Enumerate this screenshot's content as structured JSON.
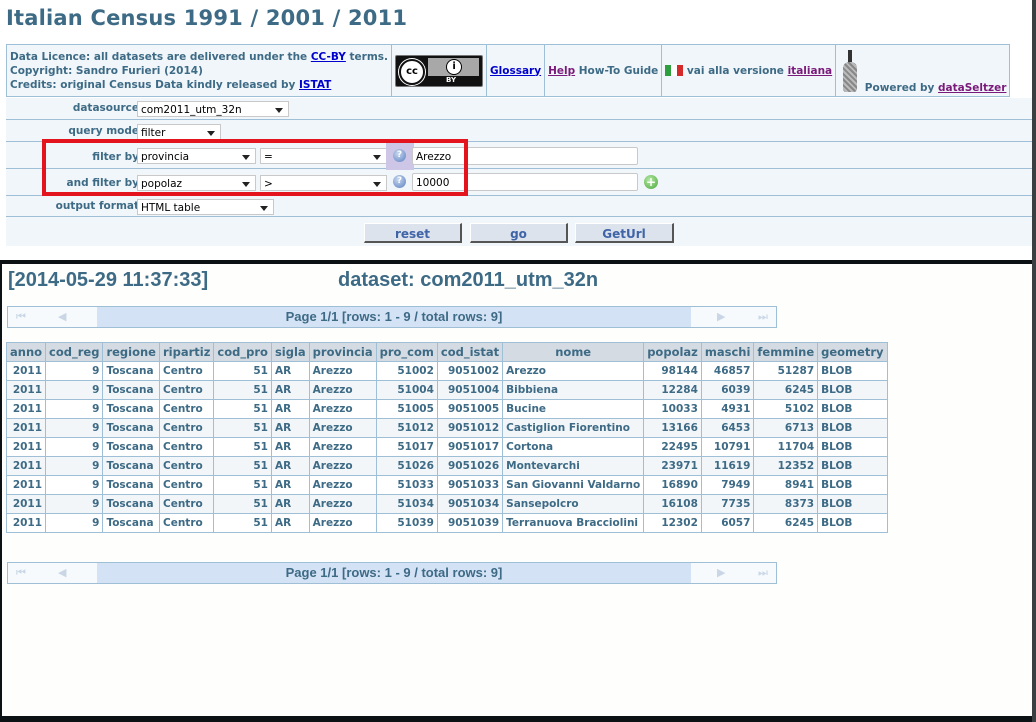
{
  "page": {
    "title": "Italian Census 1991 / 2001 / 2011"
  },
  "info": {
    "licence_prefix": "Data Licence: all datasets are delivered under the ",
    "licence_link": "CC-BY",
    "licence_suffix": " terms.",
    "copyright": "Copyright: Sandro Furieri (2014)",
    "credits_prefix": "Credits: original Census Data kindly released by ",
    "credits_link": "ISTAT",
    "cc_badge": {
      "cc": "cc",
      "by": "BY",
      "by_icon": "i"
    },
    "glossary_link": "Glossary",
    "help_link": "Help",
    "howto_text": " How-To Guide",
    "italian_text": " vai alla versione ",
    "italian_link": "italiana",
    "powered_text": "Powered by ",
    "powered_link": "dataSeltzer"
  },
  "form": {
    "datasource": {
      "label": "datasource",
      "value": "com2011_utm_32n"
    },
    "query_mode": {
      "label": "query mode",
      "value": "filter"
    },
    "filter1": {
      "label": "filter by",
      "field": "provincia",
      "operator": "=",
      "value": "Arezzo"
    },
    "filter2": {
      "label": "and filter by",
      "field": "popolaz",
      "operator": ">",
      "value": "10000"
    },
    "output_format": {
      "label": "output format",
      "value": "HTML table"
    },
    "help_icon": "?",
    "add_icon": "+",
    "buttons": {
      "reset": "reset",
      "go": "go",
      "geturl": "GetUrl"
    }
  },
  "result": {
    "timestamp": "[2014-05-29 11:37:33]",
    "dataset": "dataset: com2011_utm_32n",
    "pager_text": "Page 1/1 [rows: 1 - 9 / total rows: 9]",
    "pager_icons": {
      "first": "⏮",
      "prev": "◀",
      "next": "▶",
      "last": "⏭"
    },
    "columns": [
      "anno",
      "cod_reg",
      "regione",
      "ripartiz",
      "cod_pro",
      "sigla",
      "provincia",
      "pro_com",
      "cod_istat",
      "nome",
      "popolaz",
      "maschi",
      "femmine",
      "geometry"
    ],
    "rows": [
      [
        "2011",
        "9",
        "Toscana",
        "Centro",
        "51",
        "AR",
        "Arezzo",
        "51002",
        "9051002",
        "Arezzo",
        "98144",
        "46857",
        "51287",
        "BLOB"
      ],
      [
        "2011",
        "9",
        "Toscana",
        "Centro",
        "51",
        "AR",
        "Arezzo",
        "51004",
        "9051004",
        "Bibbiena",
        "12284",
        "6039",
        "6245",
        "BLOB"
      ],
      [
        "2011",
        "9",
        "Toscana",
        "Centro",
        "51",
        "AR",
        "Arezzo",
        "51005",
        "9051005",
        "Bucine",
        "10033",
        "4931",
        "5102",
        "BLOB"
      ],
      [
        "2011",
        "9",
        "Toscana",
        "Centro",
        "51",
        "AR",
        "Arezzo",
        "51012",
        "9051012",
        "Castiglion Fiorentino",
        "13166",
        "6453",
        "6713",
        "BLOB"
      ],
      [
        "2011",
        "9",
        "Toscana",
        "Centro",
        "51",
        "AR",
        "Arezzo",
        "51017",
        "9051017",
        "Cortona",
        "22495",
        "10791",
        "11704",
        "BLOB"
      ],
      [
        "2011",
        "9",
        "Toscana",
        "Centro",
        "51",
        "AR",
        "Arezzo",
        "51026",
        "9051026",
        "Montevarchi",
        "23971",
        "11619",
        "12352",
        "BLOB"
      ],
      [
        "2011",
        "9",
        "Toscana",
        "Centro",
        "51",
        "AR",
        "Arezzo",
        "51033",
        "9051033",
        "San Giovanni Valdarno",
        "16890",
        "7949",
        "8941",
        "BLOB"
      ],
      [
        "2011",
        "9",
        "Toscana",
        "Centro",
        "51",
        "AR",
        "Arezzo",
        "51034",
        "9051034",
        "Sansepolcro",
        "16108",
        "7735",
        "8373",
        "BLOB"
      ],
      [
        "2011",
        "9",
        "Toscana",
        "Centro",
        "51",
        "AR",
        "Arezzo",
        "51039",
        "9051039",
        "Terranuova Bracciolini",
        "12302",
        "6057",
        "6245",
        "BLOB"
      ]
    ]
  }
}
